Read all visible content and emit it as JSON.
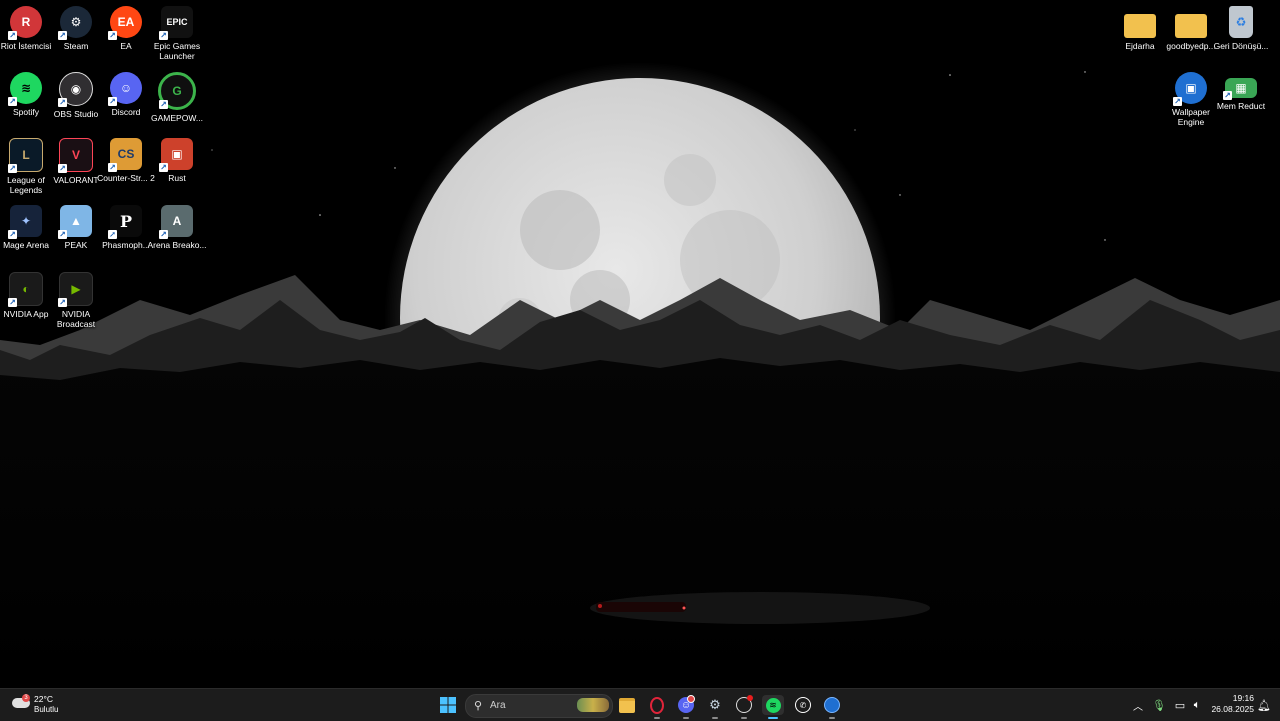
{
  "desktop_icons": [
    {
      "label": "Riot İstemcisi",
      "icon": "riot-icon",
      "color": "#d13639",
      "glyph": "R"
    },
    {
      "label": "Steam",
      "icon": "steam-icon",
      "color": "#1b2838",
      "glyph": "⚙"
    },
    {
      "label": "EA",
      "icon": "ea-icon",
      "color": "#ff4713",
      "glyph": "EA"
    },
    {
      "label": "Epic Games Launcher",
      "icon": "epic-games-icon",
      "color": "#111111",
      "glyph": "EPIC"
    },
    {
      "label": "Spotify",
      "icon": "spotify-icon",
      "color": "#1ed760",
      "glyph": "≋"
    },
    {
      "label": "OBS Studio",
      "icon": "obs-icon",
      "color": "#302e31",
      "glyph": "◉"
    },
    {
      "label": "Discord",
      "icon": "discord-icon",
      "color": "#5865f2",
      "glyph": "☺"
    },
    {
      "label": "GAMEPOW...",
      "icon": "gamepower-icon",
      "color": "#0f0f0f",
      "glyph": "G"
    },
    {
      "label": "League of Legends",
      "icon": "league-icon",
      "color": "#0a1a28",
      "glyph": "L"
    },
    {
      "label": "VALORANT",
      "icon": "valorant-icon",
      "color": "#fd4556",
      "glyph": "V"
    },
    {
      "label": "Counter-Str... 2",
      "icon": "counter-strike-icon",
      "color": "#de9b35",
      "glyph": "CS"
    },
    {
      "label": "Rust",
      "icon": "rust-icon",
      "color": "#cd412b",
      "glyph": "▣"
    },
    {
      "label": "Mage Arena",
      "icon": "mage-arena-icon",
      "color": "#16233a",
      "glyph": "✦"
    },
    {
      "label": "PEAK",
      "icon": "peak-icon",
      "color": "#7fb6e6",
      "glyph": "▲"
    },
    {
      "label": "Phasmoph...",
      "icon": "phasmophobia-icon",
      "color": "#0a0a0a",
      "glyph": "P"
    },
    {
      "label": "Arena Breako...",
      "icon": "arena-breakout-icon",
      "color": "#5a6b6e",
      "glyph": "A"
    },
    {
      "label": "NVIDIA App",
      "icon": "nvidia-app-icon",
      "color": "#76b900",
      "glyph": "◐"
    },
    {
      "label": "NVIDIA Broadcast",
      "icon": "nvidia-broadcast-icon",
      "color": "#1a1a1a",
      "glyph": "▶"
    },
    {
      "label": "Ejdarha",
      "icon": "folder-icon",
      "color": "#f2c14e",
      "glyph": ""
    },
    {
      "label": "goodbyedp...",
      "icon": "folder-icon",
      "color": "#f2c14e",
      "glyph": ""
    },
    {
      "label": "Geri Dönüşü...",
      "icon": "recycle-bin-icon",
      "color": "#bfc7cf",
      "glyph": "♻"
    },
    {
      "label": "Wallpaper Engine",
      "icon": "wallpaper-engine-icon",
      "color": "#1f6fd1",
      "glyph": "▣"
    },
    {
      "label": "Mem Reduct",
      "icon": "mem-reduct-icon",
      "color": "#3aa655",
      "glyph": "▦"
    }
  ],
  "taskbar": {
    "weather": {
      "temp": "22°C",
      "condition": "Bulutlu",
      "badge": "3"
    },
    "search_placeholder": "Ara",
    "apps": [
      "start-icon",
      "search-icon",
      "file-explorer-icon",
      "opera-icon",
      "discord-icon",
      "steam-icon",
      "obs-icon",
      "spotify-icon",
      "whatsapp-icon",
      "wallpaper-engine-icon"
    ],
    "clock": {
      "time": "19:16",
      "date": "26.08.2025"
    }
  }
}
